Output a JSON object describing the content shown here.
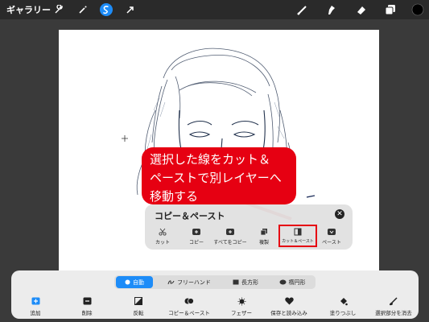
{
  "topbar": {
    "gallery_label": "ギャラリー",
    "tools_left": [
      "wrench-icon",
      "magic-wand-icon",
      "selection-icon",
      "transform-arrow-icon"
    ],
    "tools_right": [
      "brush-icon",
      "smudge-icon",
      "eraser-icon",
      "layers-icon",
      "color-swatch"
    ],
    "active_tool": "selection-icon",
    "active_color": "#1d8cf8",
    "current_color": "#000000"
  },
  "callout": {
    "line1": "選択した線をカット＆",
    "line2": "ペーストで別レイヤーへ",
    "line3": "移動する",
    "color": "#e60012"
  },
  "copy_panel": {
    "title": "コピー＆ペースト",
    "items": [
      {
        "label": "カット",
        "icon": "scissors-icon"
      },
      {
        "label": "コピー",
        "icon": "copy-icon"
      },
      {
        "label": "すべてをコピー",
        "icon": "copy-all-icon"
      },
      {
        "label": "複製",
        "icon": "duplicate-icon"
      },
      {
        "label": "カット＆ペースト",
        "icon": "cut-paste-icon"
      },
      {
        "label": "ペースト",
        "icon": "paste-icon"
      }
    ],
    "highlighted_item": "カット＆ペースト"
  },
  "selection_modes": {
    "items": [
      "自動",
      "フリーハンド",
      "長方形",
      "楕円形"
    ],
    "active": "自動"
  },
  "bottom_actions": [
    "追加",
    "削除",
    "反転",
    "コピー＆ペースト",
    "フェザー",
    "保存と読み込み",
    "塗りつぶし",
    "選択部分を消去"
  ]
}
